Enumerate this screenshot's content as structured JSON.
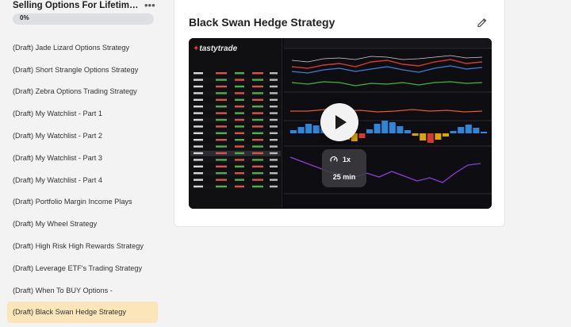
{
  "course": {
    "title": "Selling Options For Lifetime Income",
    "progress_label": "0%",
    "progress_fraction": 0
  },
  "lessons": [
    {
      "label": "(Draft) Jade Lizard Options Strategy"
    },
    {
      "label": "(Draft) Short Strangle Options Strategy"
    },
    {
      "label": "(Draft) Zebra Options Trading Strategy"
    },
    {
      "label": "(Draft) My Watchlist - Part 1"
    },
    {
      "label": "(Draft) My Watchlist - Part 2"
    },
    {
      "label": "(Draft) My Watchlist - Part 3"
    },
    {
      "label": "(Draft) My Watchlist - Part 4"
    },
    {
      "label": "(Draft) Portfolio Margin Income Plays"
    },
    {
      "label": "(Draft) My Wheel Strategy"
    },
    {
      "label": "(Draft) High Risk High Rewards Strategy"
    },
    {
      "label": "(Draft) Leverage ETF's Trading Strategy"
    },
    {
      "label": "(Draft) When To BUY Options -"
    },
    {
      "label": "(Draft) Black Swan Hedge Strategy",
      "active": true
    }
  ],
  "main": {
    "lesson_title": "Black Swan Hedge Strategy",
    "video": {
      "brand": "tastytrade",
      "speed": "1x",
      "duration": "25 min"
    }
  },
  "colors": {
    "active_lesson_bg": "#fbe6ba",
    "progress_track": "#dedfe2"
  },
  "icons": [
    "more-horizontal-icon",
    "pencil-icon",
    "play-icon",
    "speedometer-icon"
  ]
}
